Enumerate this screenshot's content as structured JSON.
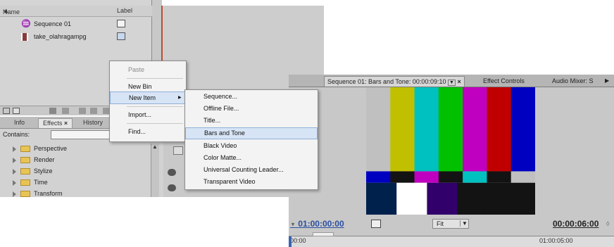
{
  "project": {
    "col_name": "Name",
    "col_label": "Label",
    "items": [
      {
        "name": "Sequence 01",
        "icon": "sequence-icon"
      },
      {
        "name": "take_olahragampg",
        "icon": "film-icon"
      }
    ]
  },
  "effects": {
    "tabs": [
      "Info",
      "Effects",
      "History"
    ],
    "close_glyph": "×",
    "contains_label": "Contains:",
    "folders": [
      "Perspective",
      "Render",
      "Stylize",
      "Time",
      "Transform"
    ]
  },
  "context_menu": {
    "items": [
      "Paste",
      "New Bin",
      "New Item",
      "Import...",
      "Find..."
    ],
    "submenu_arrow": "▶"
  },
  "submenu": {
    "items": [
      "Sequence...",
      "Offline File...",
      "Title...",
      "Bars and Tone",
      "Black Video",
      "Color Matte...",
      "Universal Counting Leader...",
      "Transparent Video"
    ],
    "highlighted": "Bars and Tone"
  },
  "monitor": {
    "tabs": [
      "Sequence 01: Bars and Tone: 00:00:09:10",
      "Effect Controls",
      "Audio Mixer: S"
    ],
    "tab_menu_glyph": "▼",
    "tab_close_glyph": "×",
    "timecode_current": "01:00:00:00",
    "timecode_duration": "00:00:06:00",
    "zoom_value": "Fit",
    "ruler_start": "00:00",
    "ruler_end": "01:00:05:00",
    "colors": {
      "bars_top": [
        "#c0c0c0",
        "#c0c000",
        "#00c0c0",
        "#00c000",
        "#c000c0",
        "#c00000",
        "#0000c0"
      ],
      "bars_mid": [
        "#0000c0",
        "#131313",
        "#c000c0",
        "#131313",
        "#00c0c0",
        "#131313",
        "#c0c0c0"
      ],
      "bars_bottom": [
        "#00214c",
        "#ffffff",
        "#32006a",
        "#131313",
        "#131313",
        "#131313"
      ]
    }
  }
}
